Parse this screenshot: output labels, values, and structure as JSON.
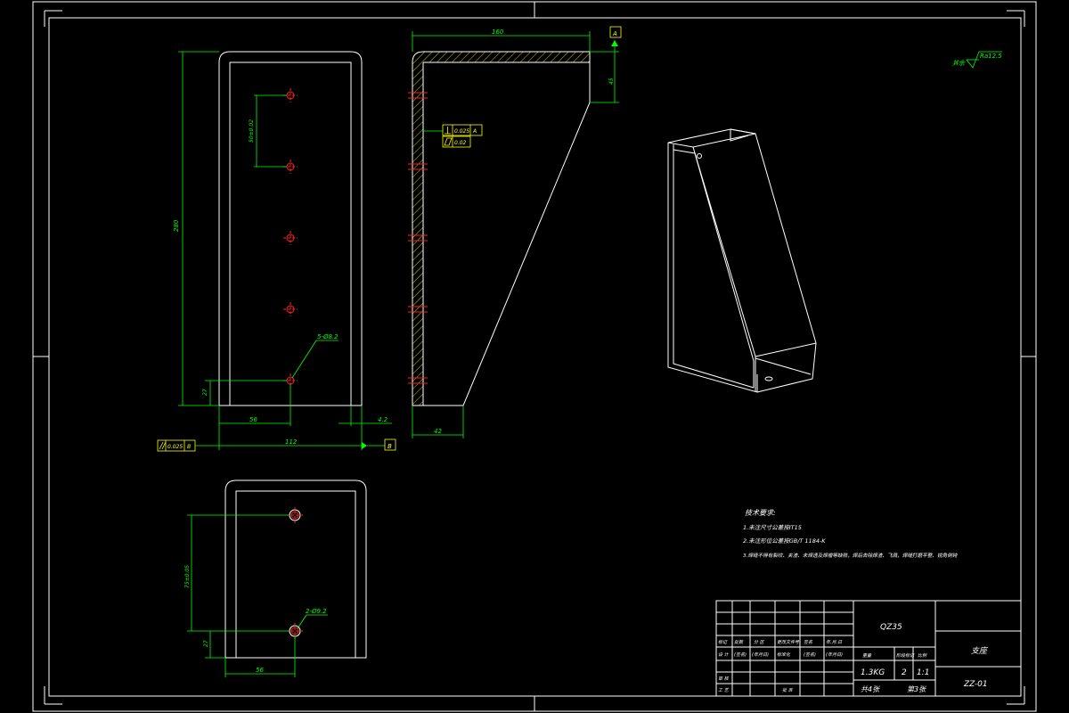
{
  "drawing": {
    "dims": {
      "height_280": "280",
      "hole_spacing": "50±0.02",
      "hole_offset_27": "27",
      "dim_56": "56",
      "dim_112": "112",
      "dim_4_2": "4.2",
      "holes_callout": "5-Ø8.2",
      "width_160": "160",
      "dim_45": "45",
      "dim_42": "42",
      "bottom_spacing": "75±0.05",
      "bottom_27": "27",
      "bottom_56": "56",
      "bottom_holes": "2-Ø9.2"
    },
    "datums": {
      "a": "A",
      "b": "B"
    },
    "tolerances": {
      "parallel_value": "0.025",
      "parallel_datum": "B",
      "perp_value": "0.025",
      "perp_datum": "A",
      "flat_value": "0.02"
    },
    "surface_finish": {
      "label": "其余",
      "value": "Ra12.5"
    },
    "tech_requirements": {
      "title": "技术要求:",
      "items": [
        "1.未注尺寸公差按IT15",
        "2.未注形位公差按GB/T 1184-K",
        "3.焊缝不得有裂纹、夹渣、未焊透及焊瘤等缺陷，焊后去除焊渣、飞溅，焊缝打磨平整、锐角倒钝"
      ]
    },
    "title_block": {
      "material": "QZ35",
      "part_name": "支座",
      "drawing_no": "ZZ-01",
      "weight": "1.3KG",
      "quantity": "2",
      "scale": "1:1",
      "sheets_total": "共4张",
      "sheet_no": "第3张",
      "header_cells": [
        "标记",
        "处数",
        "分  区",
        "更改文件号",
        "签名",
        "年.月.日"
      ],
      "row_design": [
        "设  计",
        "(签名)",
        "(年月日)",
        "标准化",
        "(签名)",
        "(年月日)"
      ],
      "row_review": "审  核",
      "row_process": "工  艺",
      "row_approve": "批  准",
      "stage_labels": [
        "重量",
        "阶段标记",
        "比例"
      ]
    }
  }
}
